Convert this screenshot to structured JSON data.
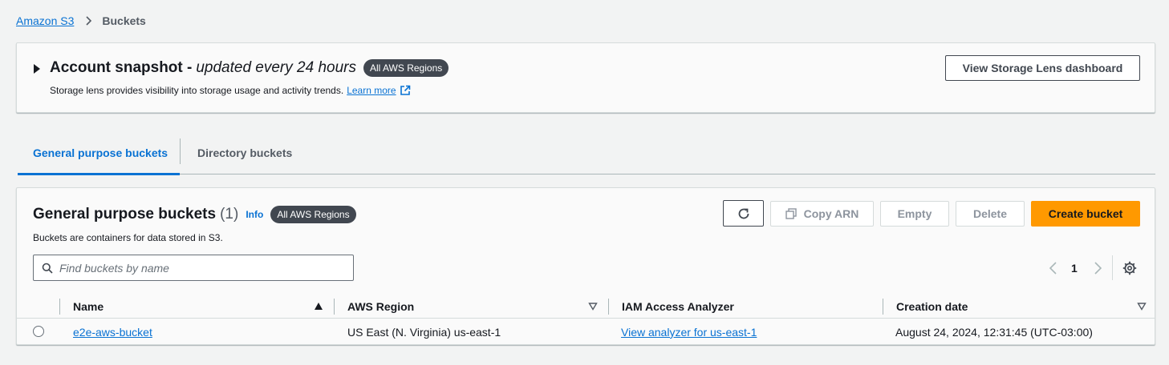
{
  "breadcrumb": {
    "root": "Amazon S3",
    "current": "Buckets"
  },
  "snapshot": {
    "title": "Account snapshot -",
    "subtitle": "updated every 24 hours",
    "badge": "All AWS Regions",
    "description": "Storage lens provides visibility into storage usage and activity trends.",
    "learn_more": "Learn more",
    "dashboard_button": "View Storage Lens dashboard"
  },
  "tabs": [
    {
      "label": "General purpose buckets",
      "active": true
    },
    {
      "label": "Directory buckets",
      "active": false
    }
  ],
  "panel": {
    "title": "General purpose buckets",
    "count": "(1)",
    "info": "Info",
    "badge": "All AWS Regions",
    "description": "Buckets are containers for data stored in S3.",
    "buttons": {
      "refresh_icon": "refresh-icon",
      "copy_arn": "Copy ARN",
      "empty": "Empty",
      "delete": "Delete",
      "create": "Create bucket"
    },
    "search": {
      "placeholder": "Find buckets by name",
      "value": ""
    },
    "pagination": {
      "page": "1"
    }
  },
  "table": {
    "columns": [
      "Name",
      "AWS Region",
      "IAM Access Analyzer",
      "Creation date"
    ],
    "rows": [
      {
        "name": "e2e-aws-bucket",
        "region": "US East (N. Virginia) us-east-1",
        "analyzer": "View analyzer for us-east-1",
        "created": "August 24, 2024, 12:31:45 (UTC-03:00)"
      }
    ]
  },
  "colors": {
    "link": "#0972d3",
    "primary_button": "#ff9900",
    "badge_bg": "#414750",
    "page_bg": "#f2f3f3"
  }
}
